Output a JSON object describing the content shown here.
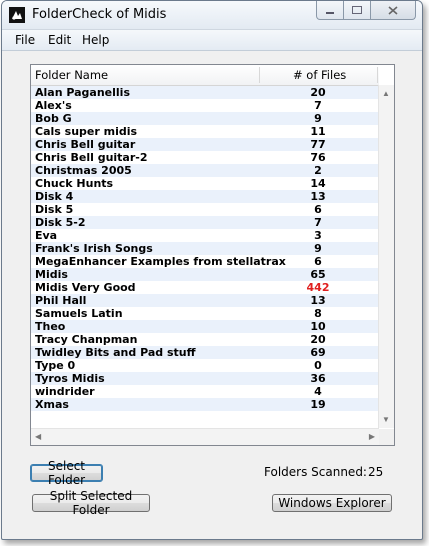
{
  "window": {
    "title": "FolderCheck of Midis"
  },
  "menu": [
    {
      "label": "File"
    },
    {
      "label": "Edit"
    },
    {
      "label": "Help"
    }
  ],
  "list": {
    "columns": [
      "Folder Name",
      "# of Files"
    ],
    "rows": [
      {
        "name": "Alan Paganellis",
        "count": "20"
      },
      {
        "name": "Alex's",
        "count": "7"
      },
      {
        "name": "Bob G",
        "count": "9"
      },
      {
        "name": "Cals super midis",
        "count": "11"
      },
      {
        "name": "Chris Bell guitar",
        "count": "77"
      },
      {
        "name": "Chris Bell guitar-2",
        "count": "76"
      },
      {
        "name": "Christmas 2005",
        "count": "2"
      },
      {
        "name": "Chuck Hunts",
        "count": "14"
      },
      {
        "name": "Disk 4",
        "count": "13"
      },
      {
        "name": "Disk 5",
        "count": "6"
      },
      {
        "name": "Disk 5-2",
        "count": "7"
      },
      {
        "name": "Eva",
        "count": "3"
      },
      {
        "name": "Frank's Irish Songs",
        "count": "9"
      },
      {
        "name": "MegaEnhancer Examples from stellatrax",
        "count": "6"
      },
      {
        "name": "Midis",
        "count": "65"
      },
      {
        "name": "Midis Very Good",
        "count": "442",
        "highlight_color": "#e02020"
      },
      {
        "name": "Phil Hall",
        "count": "13"
      },
      {
        "name": "Samuels Latin",
        "count": "8"
      },
      {
        "name": "Theo",
        "count": "10"
      },
      {
        "name": "Tracy Chanpman",
        "count": "20"
      },
      {
        "name": "Twidley Bits and Pad stuff",
        "count": "69"
      },
      {
        "name": "Type 0",
        "count": "0"
      },
      {
        "name": "Tyros Midis",
        "count": "36"
      },
      {
        "name": "windrider",
        "count": "4"
      },
      {
        "name": "Xmas",
        "count": "19"
      }
    ]
  },
  "buttons": {
    "select_folder": "Select Folder",
    "split_folder": "Split Selected Folder",
    "windows_explorer": "Windows Explorer"
  },
  "status": {
    "scanned_label": "Folders Scanned:",
    "scanned_value": "25"
  },
  "colors": {
    "row_alt": "#eaf1fb",
    "highlight": "#e02020"
  }
}
